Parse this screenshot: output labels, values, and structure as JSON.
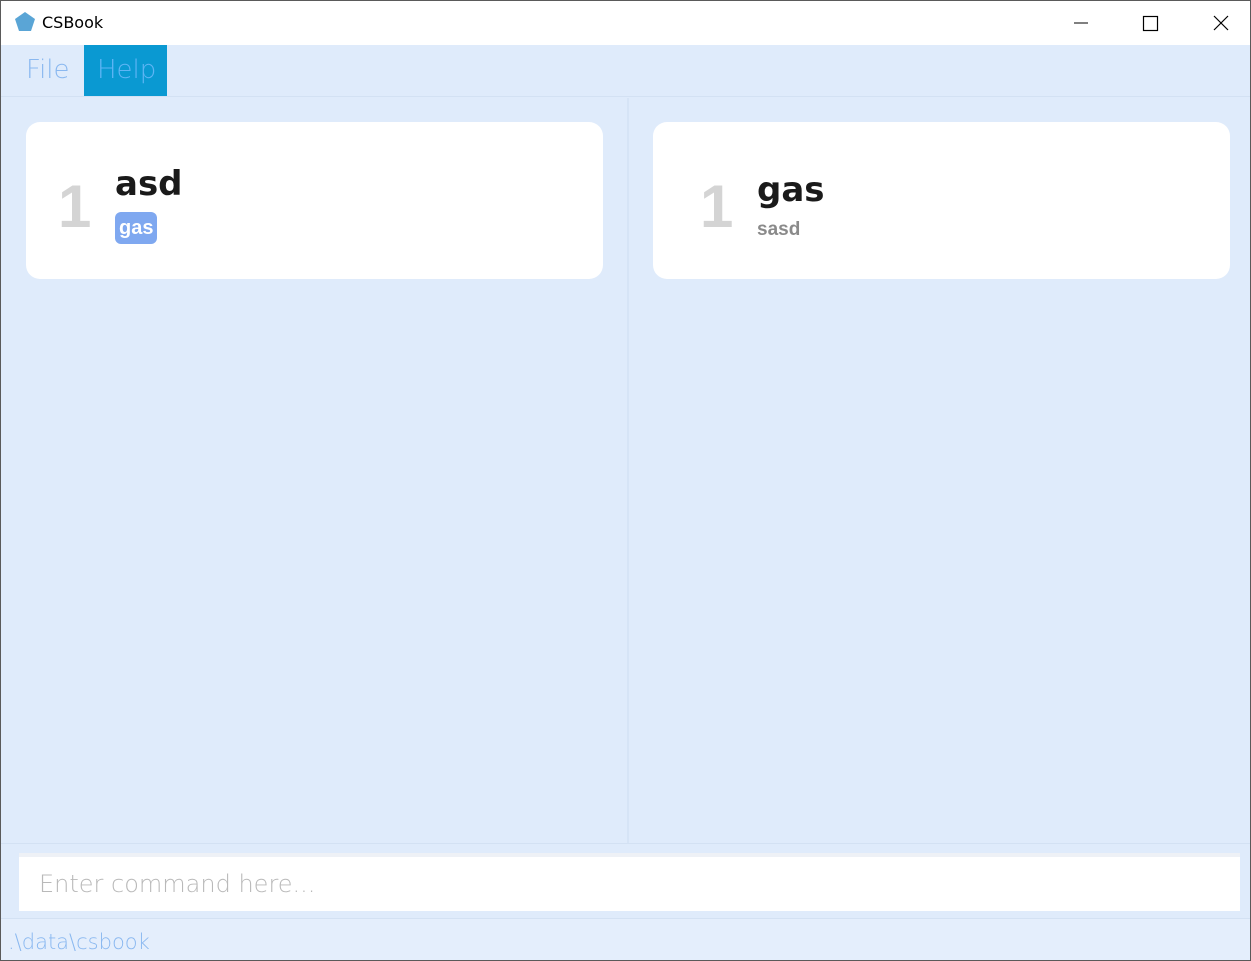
{
  "window": {
    "title": "CSBook",
    "icon": "pentagon-app-icon",
    "controls": [
      "minimize-icon",
      "maximize-icon",
      "close-icon"
    ]
  },
  "menu": {
    "items": [
      {
        "label": "File"
      },
      {
        "label": "Help"
      }
    ]
  },
  "left_panel": {
    "cards": [
      {
        "index": "1",
        "title": "asd",
        "tag": "gas"
      }
    ]
  },
  "right_panel": {
    "cards": [
      {
        "index": "1",
        "title": "gas",
        "subtitle": "sasd"
      }
    ]
  },
  "command": {
    "placeholder": "Enter command here...",
    "value": ""
  },
  "status": {
    "path": ".\\data\\csbook"
  },
  "colors": {
    "background": "#dfebfb",
    "menu_active": "#0a99d2",
    "menu_text": "#8ab8f0",
    "tag": "#7fa8f0",
    "index": "#d4d4d4"
  }
}
